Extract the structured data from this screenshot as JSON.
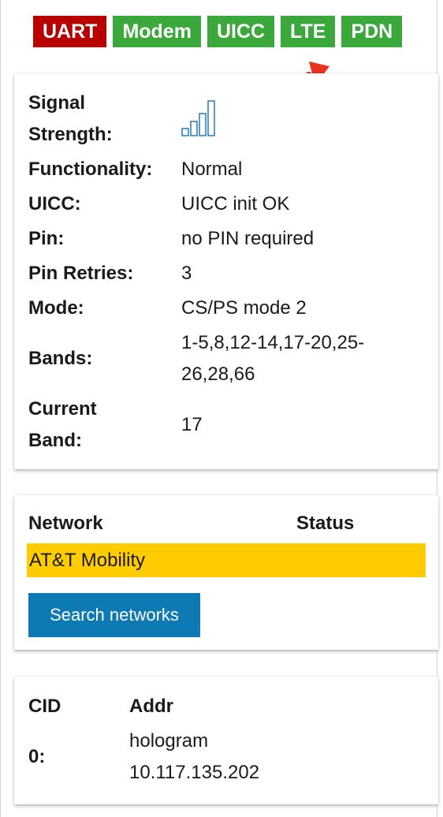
{
  "tabs": [
    {
      "label": "UART",
      "status": "error"
    },
    {
      "label": "Modem",
      "status": "ok"
    },
    {
      "label": "UICC",
      "status": "ok"
    },
    {
      "label": "LTE",
      "status": "ok"
    },
    {
      "label": "PDN",
      "status": "ok"
    }
  ],
  "status_panel": {
    "signal_label_line1": "Signal",
    "signal_label_line2": "Strength:",
    "signal_icon": "signal-bars-icon",
    "functionality_label": "Functionality:",
    "functionality_value": "Normal",
    "uicc_label": "UICC:",
    "uicc_value": "UICC init OK",
    "pin_label": "Pin:",
    "pin_value": "no PIN required",
    "pin_retries_label": "Pin Retries:",
    "pin_retries_value": "3",
    "mode_label": "Mode:",
    "mode_value": "CS/PS mode 2",
    "bands_label": "Bands:",
    "bands_value_line1": "1-5,8,12-14,17-20,25-",
    "bands_value_line2": "26,28,66",
    "current_band_label_line1": "Current",
    "current_band_label_line2": "Band:",
    "current_band_value": "17"
  },
  "network_panel": {
    "network_header": "Network",
    "status_header": "Status",
    "rows": [
      {
        "network": "AT&T Mobility",
        "status": ""
      }
    ],
    "search_button": "Search networks"
  },
  "pdn_panel": {
    "cid_header": "CID",
    "addr_header": "Addr",
    "rows": [
      {
        "cid": "0:",
        "apn": "hologram",
        "ip": "10.117.135.202"
      }
    ]
  },
  "colors": {
    "tab_error": "#b80000",
    "tab_ok": "#3aa83a",
    "selected_row": "#ffcc00",
    "button": "#0e7ab3",
    "signal_icon": "#1f7bbf"
  }
}
